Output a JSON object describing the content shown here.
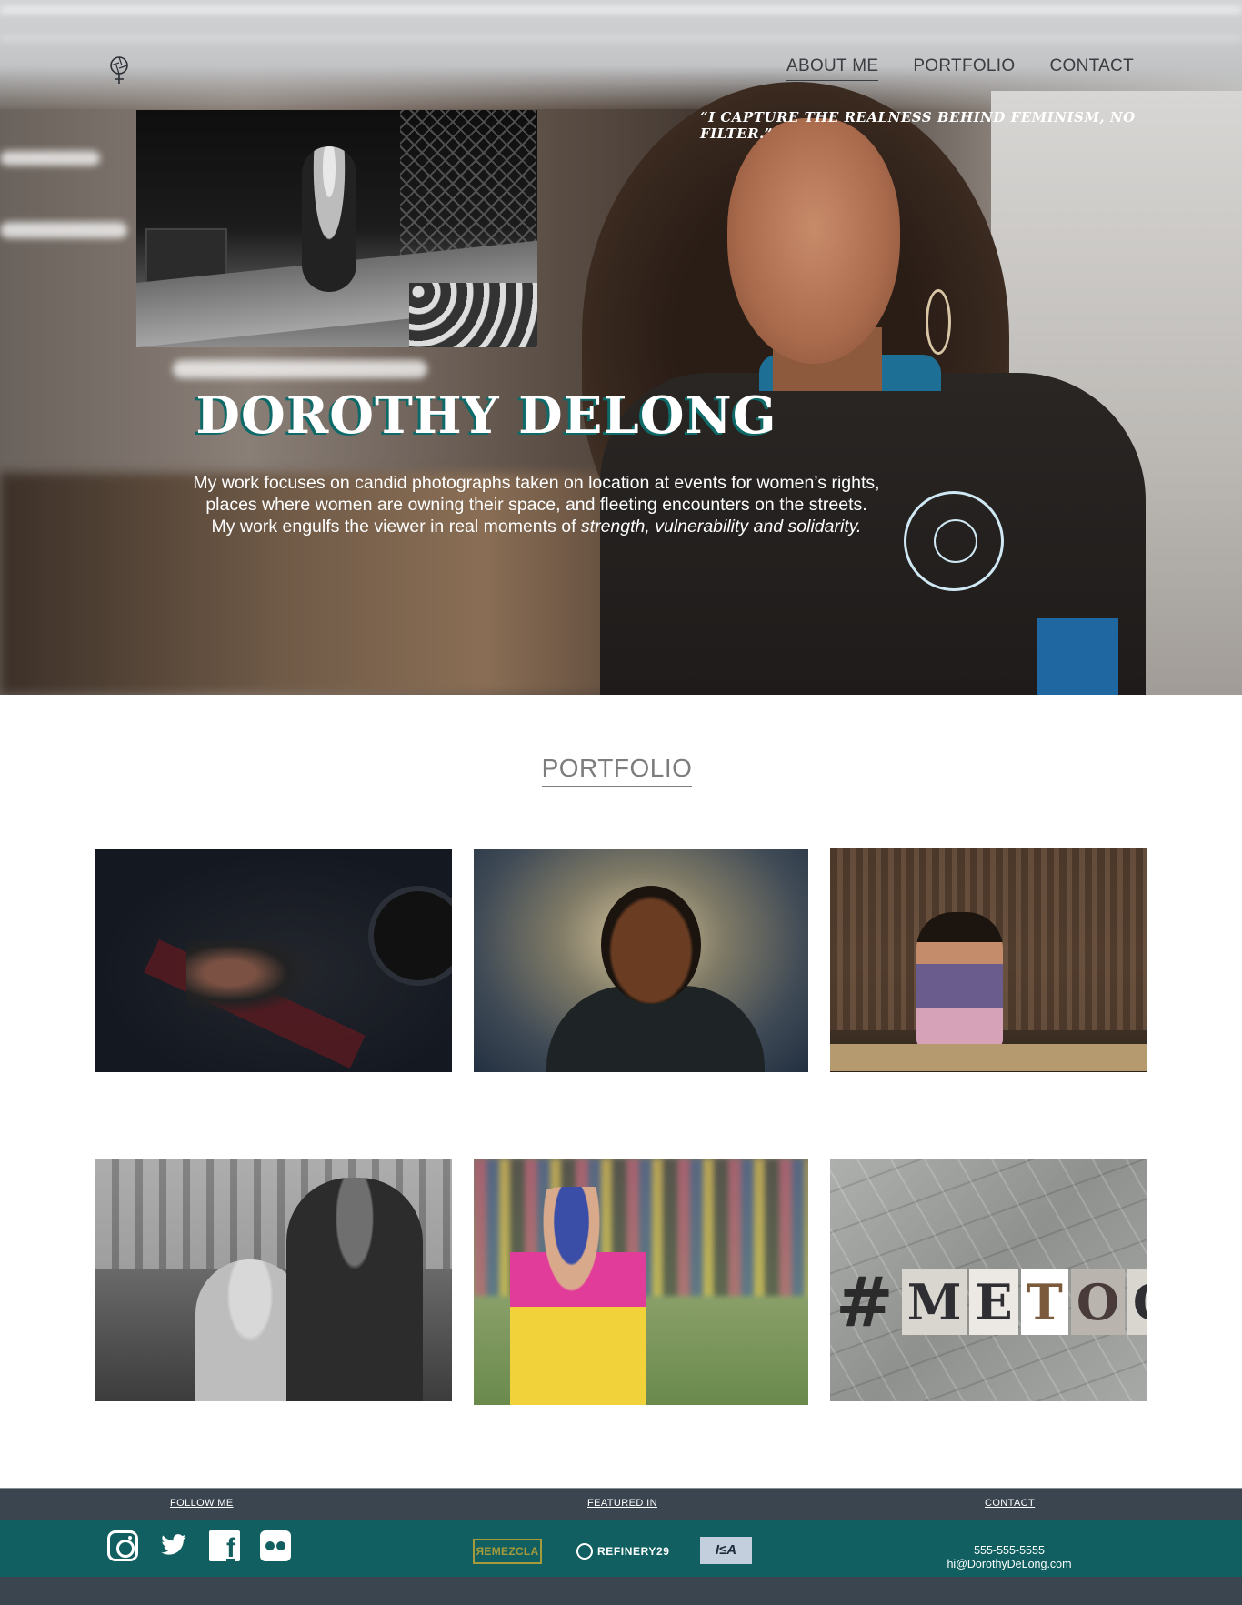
{
  "nav": {
    "items": [
      "ABOUT ME",
      "PORTFOLIO",
      "CONTACT"
    ],
    "active": "ABOUT ME"
  },
  "hero": {
    "quote": "“I CAPTURE THE REALNESS BEHIND FEMINISM, NO FILTER.”",
    "title": "DOROTHY DELONG",
    "text_1": "My work focuses on candid photographs taken on location at events for women’s rights,",
    "text_2": "places where women are owning their space, and fleeting encounters on the streets.",
    "text_3": "My work engulfs the viewer in real moments of ",
    "text_3_emphasis": "strength, vulnerability and solidarity.",
    "title_shadow_color": "#0e6a68"
  },
  "portfolio": {
    "title": "PORTFOLIO",
    "metoo_letters": [
      "#",
      "M",
      "E",
      "T",
      "O",
      "O"
    ]
  },
  "footer": {
    "follow_label": "FOLLOW ME",
    "featured_label": "FEATURED IN",
    "contact_label": "CONTACT",
    "press": {
      "remezcla": "ЯEMEZCLA",
      "refinery": "REFINERY29",
      "isa": "I≤A"
    },
    "phone": "555-555-5555",
    "email": "hi@DorothyDeLong.com",
    "colors": {
      "bar": "#3a4550",
      "band": "#115f60"
    }
  }
}
